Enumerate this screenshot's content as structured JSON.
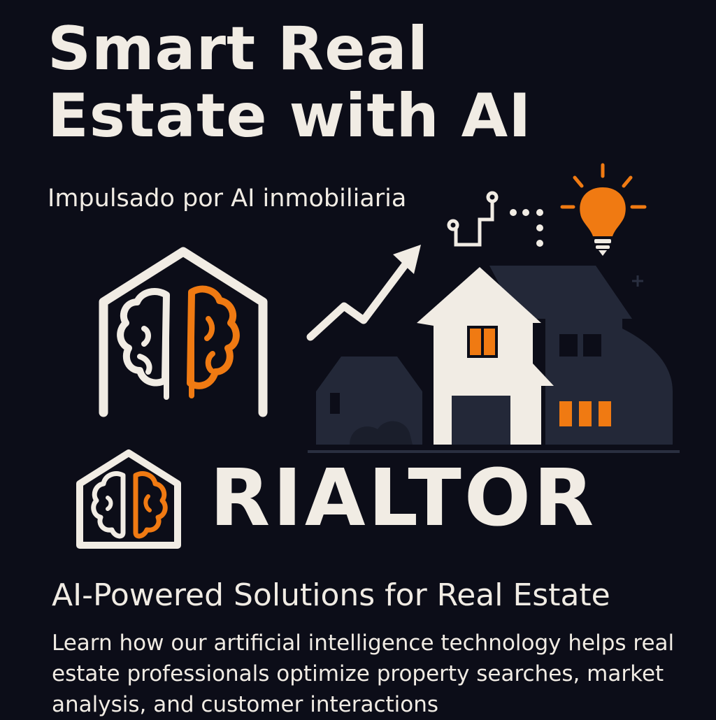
{
  "hero": {
    "title_line1": "Smart Real",
    "title_line2": "Estate with AI",
    "subtitle": "Impulsado por AI inmobiliaria"
  },
  "brand": {
    "name": "RIALTOR"
  },
  "section": {
    "heading": "AI-Powered Solutions for Real Estate",
    "description": "Learn how our artificial intelligence technology helps real estate professionals optimize property searches, market analysis, and customer interactions"
  },
  "colors": {
    "background": "#0c0d18",
    "text": "#f1ece4",
    "accent": "#f07a12",
    "house_dark": "#232838"
  },
  "icons": [
    "house-brain-icon",
    "trend-arrow-icon",
    "circuit-icon",
    "lightbulb-icon",
    "houses-icon"
  ]
}
